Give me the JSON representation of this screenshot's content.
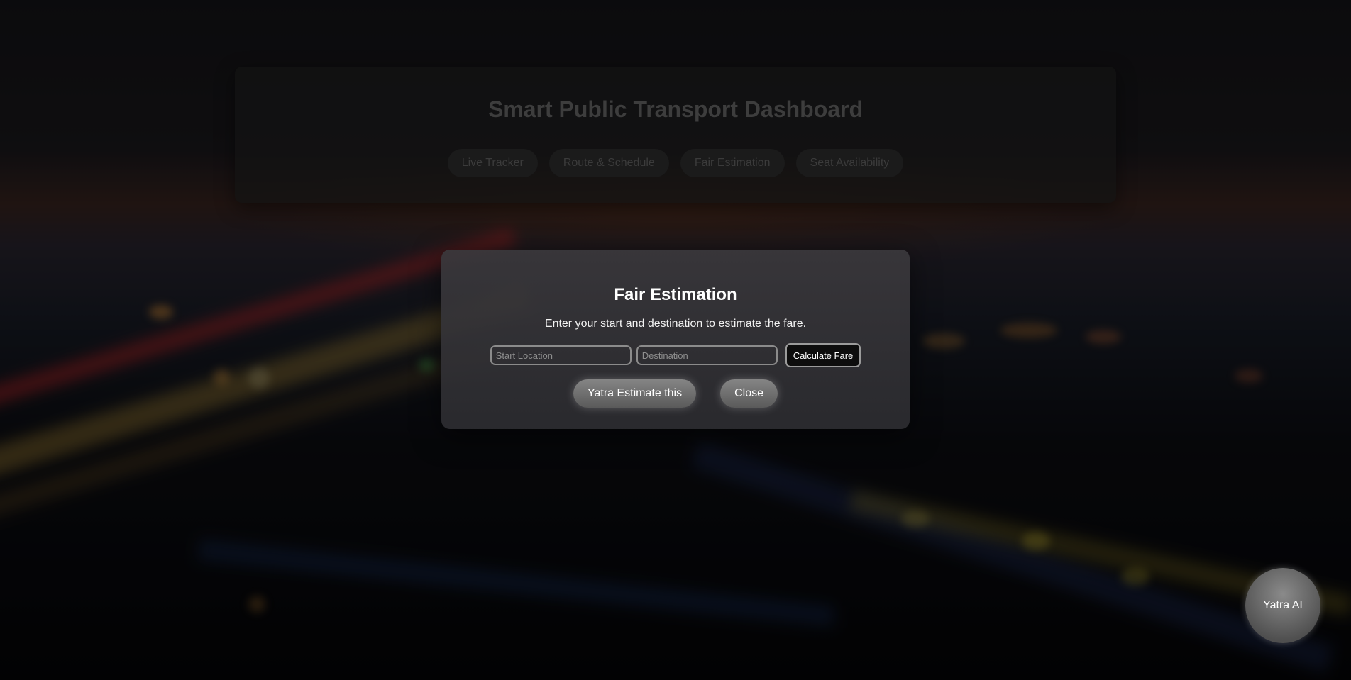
{
  "dashboard": {
    "title": "Smart Public Transport Dashboard",
    "nav": [
      {
        "label": "Live Tracker"
      },
      {
        "label": "Route & Schedule"
      },
      {
        "label": "Fair Estimation"
      },
      {
        "label": "Seat Availability"
      }
    ]
  },
  "modal": {
    "title": "Fair Estimation",
    "description": "Enter your start and destination to estimate the fare.",
    "start_placeholder": "Start Location",
    "start_value": "",
    "destination_placeholder": "Destination",
    "destination_value": "",
    "calculate_label": "Calculate Fare",
    "yatra_estimate_label": "Yatra Estimate this",
    "close_label": "Close"
  },
  "assistant": {
    "label": "Yatra AI"
  }
}
